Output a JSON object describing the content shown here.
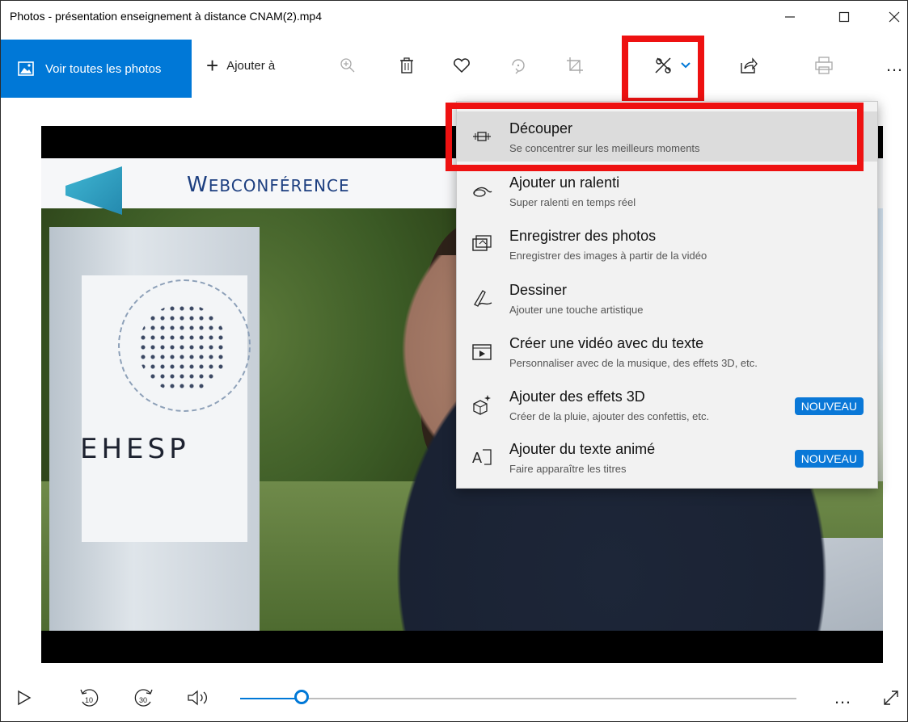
{
  "window": {
    "title": "Photos - présentation enseignement à distance CNAM(2).mp4",
    "minimize_glyph": "—",
    "maximize_glyph": "☐",
    "close_glyph": "✕"
  },
  "toolbar": {
    "view_all_label": "Voir toutes les photos",
    "add_to_label": "Ajouter à",
    "more_glyph": "…",
    "icons": [
      "photos-icon",
      "plus-icon",
      "zoom-in-icon",
      "delete-icon",
      "heart-icon",
      "rotate-icon",
      "crop-icon",
      "edit-create-icon",
      "chevron-down-icon",
      "share-icon",
      "print-icon",
      "more-icon"
    ]
  },
  "video": {
    "banner_text": "Webconférence",
    "sign_text": "EHESP"
  },
  "menu": {
    "items": [
      {
        "title": "Découper",
        "subtitle": "Se concentrer sur les meilleurs moments",
        "icon": "trim-icon",
        "badge": ""
      },
      {
        "title": "Ajouter un ralenti",
        "subtitle": "Super ralenti en temps réel",
        "icon": "slow-motion-icon",
        "badge": ""
      },
      {
        "title": "Enregistrer des photos",
        "subtitle": "Enregistrer des images à partir de la vidéo",
        "icon": "save-photos-icon",
        "badge": ""
      },
      {
        "title": "Dessiner",
        "subtitle": "Ajouter une touche artistique",
        "icon": "draw-icon",
        "badge": ""
      },
      {
        "title": "Créer une vidéo avec du texte",
        "subtitle": "Personnaliser avec de la musique, des effets 3D, etc.",
        "icon": "video-text-icon",
        "badge": ""
      },
      {
        "title": "Ajouter des effets 3D",
        "subtitle": "Créer de la pluie, ajouter des confettis, etc.",
        "icon": "effects-3d-icon",
        "badge": "NOUVEAU"
      },
      {
        "title": "Ajouter du texte animé",
        "subtitle": "Faire apparaître les titres",
        "icon": "animated-text-icon",
        "badge": "NOUVEAU"
      }
    ]
  },
  "player": {
    "rewind_label": "10",
    "forward_label": "30",
    "progress_fraction": 0.11,
    "more_glyph": "…",
    "icons": [
      "play-icon",
      "rewind-10-icon",
      "forward-30-icon",
      "volume-icon",
      "more-icon",
      "fullscreen-icon"
    ]
  },
  "colors": {
    "accent": "#0078d7",
    "highlight_border": "#ee1111",
    "badge": "#0a78d7"
  }
}
